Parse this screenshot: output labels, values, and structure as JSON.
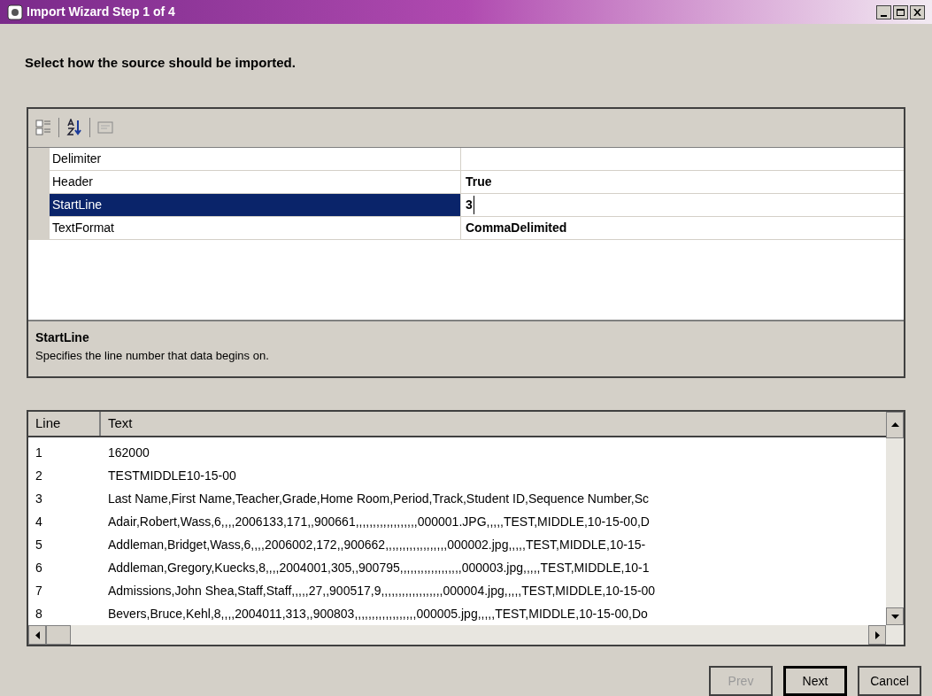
{
  "window": {
    "title": "Import Wizard Step 1 of 4"
  },
  "instruction": "Select how the source should be imported.",
  "properties": [
    {
      "name": "Delimiter",
      "selected": false
    },
    {
      "name": "Header",
      "value": "True",
      "selected": false
    },
    {
      "name": "StartLine",
      "value": "3",
      "selected": true
    },
    {
      "name": "TextFormat",
      "value": "CommaDelimited",
      "selected": false
    }
  ],
  "description": {
    "title": "StartLine",
    "text": "Specifies the line number that data begins on."
  },
  "preview": {
    "columns": [
      "Line",
      "Text"
    ],
    "rows": [
      {
        "line": "1",
        "text": "162000"
      },
      {
        "line": "2",
        "text": "TESTMIDDLE10-15-00"
      },
      {
        "line": "3",
        "text": "Last Name,First Name,Teacher,Grade,Home Room,Period,Track,Student ID,Sequence Number,Sc"
      },
      {
        "line": "4",
        "text": "Adair,Robert,Wass,6,,,,2006133,171,,900661,,,,,,,,,,,,,,,,,,000001.JPG,,,,,TEST,MIDDLE,10-15-00,D"
      },
      {
        "line": "5",
        "text": "Addleman,Bridget,Wass,6,,,,2006002,172,,900662,,,,,,,,,,,,,,,,,,000002.jpg,,,,,TEST,MIDDLE,10-15-"
      },
      {
        "line": "6",
        "text": "Addleman,Gregory,Kuecks,8,,,,2004001,305,,900795,,,,,,,,,,,,,,,,,,000003.jpg,,,,,TEST,MIDDLE,10-1"
      },
      {
        "line": "7",
        "text": "Admissions,John Shea,Staff,Staff,,,,,27,,900517,9,,,,,,,,,,,,,,,,,,000004.jpg,,,,,TEST,MIDDLE,10-15-00"
      },
      {
        "line": "8",
        "text": "Bevers,Bruce,Kehl,8,,,,2004011,313,,900803,,,,,,,,,,,,,,,,,,000005.jpg,,,,,TEST,MIDDLE,10-15-00,Do"
      }
    ]
  },
  "buttons": [
    {
      "label": "Prev",
      "disabled": true,
      "default": false
    },
    {
      "label": "Next",
      "disabled": false,
      "default": true
    },
    {
      "label": "Cancel",
      "disabled": false,
      "default": false
    }
  ]
}
